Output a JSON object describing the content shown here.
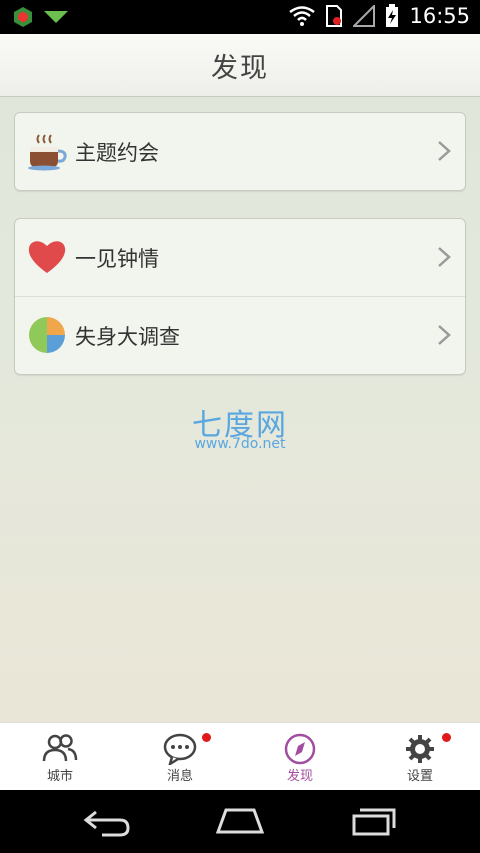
{
  "status_bar": {
    "time": "16:55"
  },
  "header": {
    "title": "发现"
  },
  "cards": [
    {
      "items": [
        {
          "label": "主题约会",
          "icon": "coffee-cup-icon"
        }
      ]
    },
    {
      "items": [
        {
          "label": "一见钟情",
          "icon": "heart-icon"
        },
        {
          "label": "失身大调查",
          "icon": "pie-chart-icon"
        }
      ]
    }
  ],
  "watermark": {
    "line1": "七度网",
    "line2": "www.7do.net"
  },
  "tabs": [
    {
      "label": "城市",
      "icon": "people-icon",
      "badge": false,
      "active": false
    },
    {
      "label": "消息",
      "icon": "chat-bubble-icon",
      "badge": true,
      "active": false
    },
    {
      "label": "发现",
      "icon": "compass-icon",
      "badge": false,
      "active": true
    },
    {
      "label": "设置",
      "icon": "gear-icon",
      "badge": true,
      "active": false
    }
  ],
  "colors": {
    "active_tab": "#a24ea0",
    "badge": "#e01a1a",
    "watermark": "#5aa7e0"
  }
}
